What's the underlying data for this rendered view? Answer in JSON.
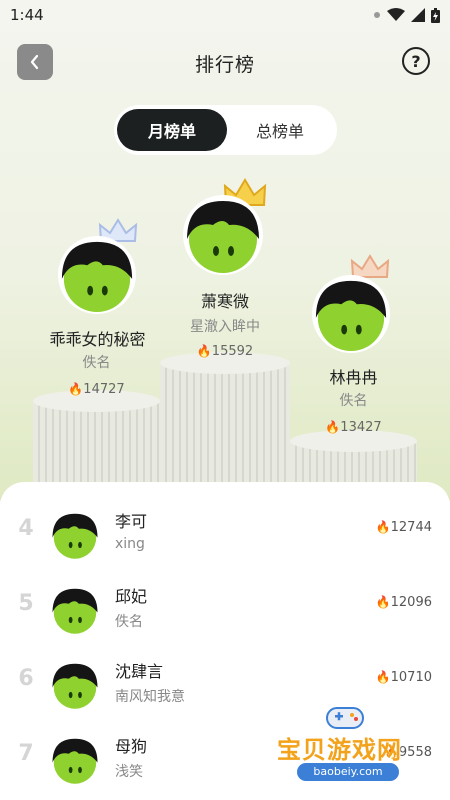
{
  "status": {
    "time": "1:44"
  },
  "header": {
    "title": "排行榜",
    "help_symbol": "?"
  },
  "tabs": [
    {
      "label": "月榜单",
      "active": true
    },
    {
      "label": "总榜单",
      "active": false
    }
  ],
  "podium": {
    "first": {
      "name": "萧寒微",
      "subtitle": "星澈入眸中",
      "score": "15592"
    },
    "second": {
      "name": "乖乖女的秘密",
      "subtitle": "佚名",
      "score": "14727"
    },
    "third": {
      "name": "林冉冉",
      "subtitle": "佚名",
      "score": "13427"
    }
  },
  "list": [
    {
      "rank": "4",
      "name": "李可",
      "subtitle": "xing",
      "score": "12744"
    },
    {
      "rank": "5",
      "name": "邱妃",
      "subtitle": "佚名",
      "score": "12096"
    },
    {
      "rank": "6",
      "name": "沈肆言",
      "subtitle": "南风知我意",
      "score": "10710"
    },
    {
      "rank": "7",
      "name": "母狗",
      "subtitle": "浅笑",
      "score": "9558"
    }
  ],
  "watermark": {
    "text": "宝贝游戏网",
    "url": "baobeiy.com"
  },
  "colors": {
    "accent_dark": "#1d2020",
    "flame": "#ff6a26",
    "avatar_green": "#8fd12e"
  }
}
